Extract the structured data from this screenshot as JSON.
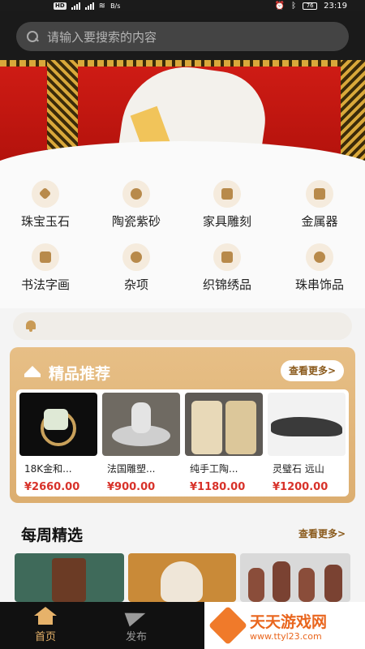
{
  "status_bar": {
    "hd_badge": "HD",
    "speed": "B/s",
    "battery": "76",
    "time": "23:19"
  },
  "search": {
    "placeholder": "请输入要搜索的内容"
  },
  "categories": [
    {
      "label": "珠宝玉石",
      "icon": "jewel-icon"
    },
    {
      "label": "陶瓷紫砂",
      "icon": "ceramic-icon"
    },
    {
      "label": "家具雕刻",
      "icon": "furniture-icon"
    },
    {
      "label": "金属器",
      "icon": "metal-icon"
    },
    {
      "label": "书法字画",
      "icon": "calligraphy-icon"
    },
    {
      "label": "杂项",
      "icon": "misc-icon"
    },
    {
      "label": "织锦绣品",
      "icon": "embroidery-icon"
    },
    {
      "label": "珠串饰品",
      "icon": "beads-icon"
    }
  ],
  "notice": {
    "icon": "bell-icon"
  },
  "featured": {
    "title": "精品推荐",
    "more": "查看更多>",
    "items": [
      {
        "name": "18K金和...",
        "price": "¥2660.00"
      },
      {
        "name": "法国雕塑...",
        "price": "¥900.00"
      },
      {
        "name": "纯手工陶...",
        "price": "¥1180.00"
      },
      {
        "name": "灵璧石 远山",
        "price": "¥1200.00"
      }
    ]
  },
  "weekly": {
    "title": "每周精选",
    "more": "查看更多>"
  },
  "nav": {
    "home": "首页",
    "publish": "发布"
  },
  "watermark": {
    "title": "天天游戏网",
    "url": "www.ttyl23.com"
  },
  "colors": {
    "accent": "#d8a564",
    "price": "#d8322a",
    "nav_active": "#e6b26a"
  }
}
